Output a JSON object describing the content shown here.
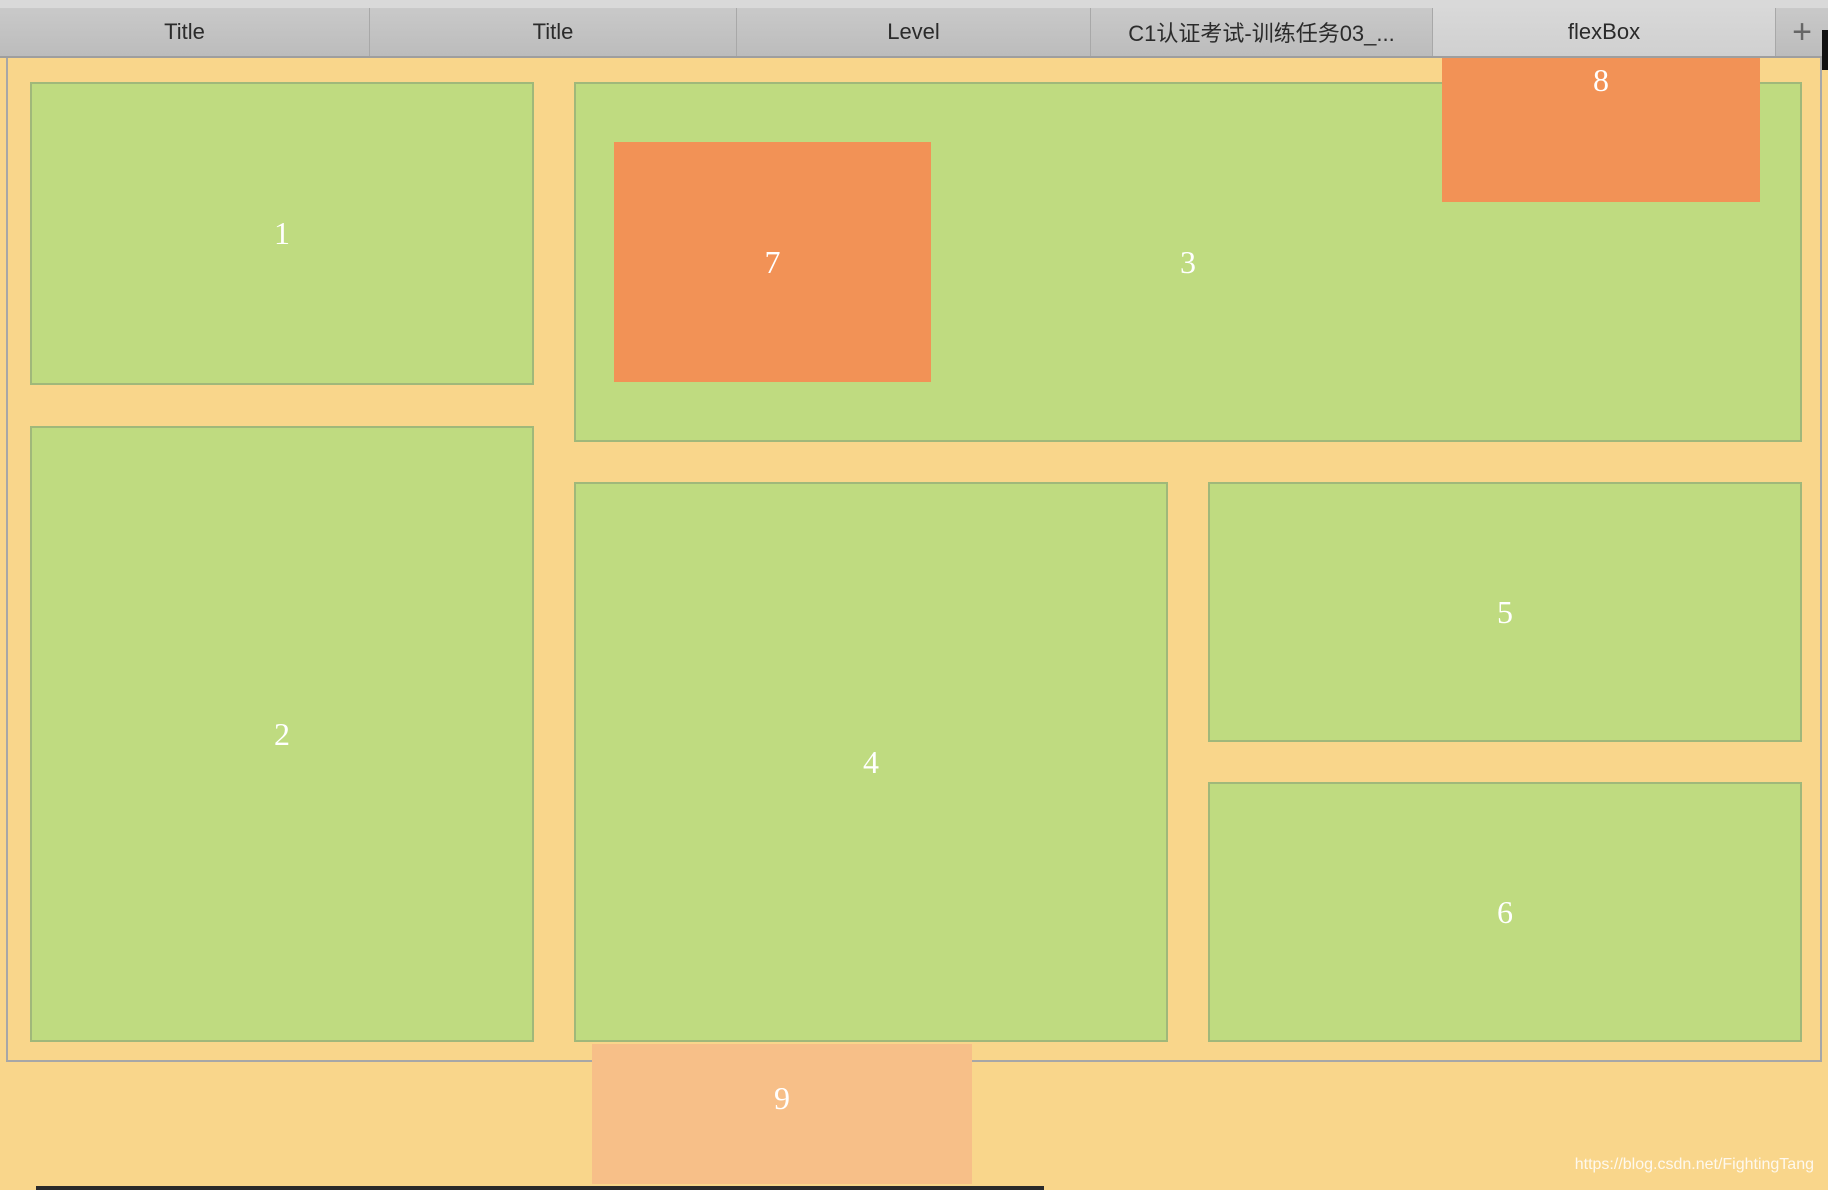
{
  "tabs": [
    {
      "label": "Title",
      "active": false
    },
    {
      "label": "Title",
      "active": false
    },
    {
      "label": "Level",
      "active": false
    },
    {
      "label": "C1认证考试-训练任务03_...",
      "active": false
    },
    {
      "label": "flexBox",
      "active": true
    }
  ],
  "add_tab_icon": "plus-icon",
  "add_tab_label": "+",
  "boxes": {
    "b1": "1",
    "b2": "2",
    "b3": "3",
    "b4": "4",
    "b5": "5",
    "b6": "6",
    "b7": "7",
    "b8": "8",
    "b9": "9"
  },
  "colors": {
    "background": "#f9d68b",
    "box_green": "#bfdb80",
    "box_orange": "#f29256",
    "box_light_orange": "#f7bf88"
  },
  "watermark": "https://blog.csdn.net/FightingTang"
}
